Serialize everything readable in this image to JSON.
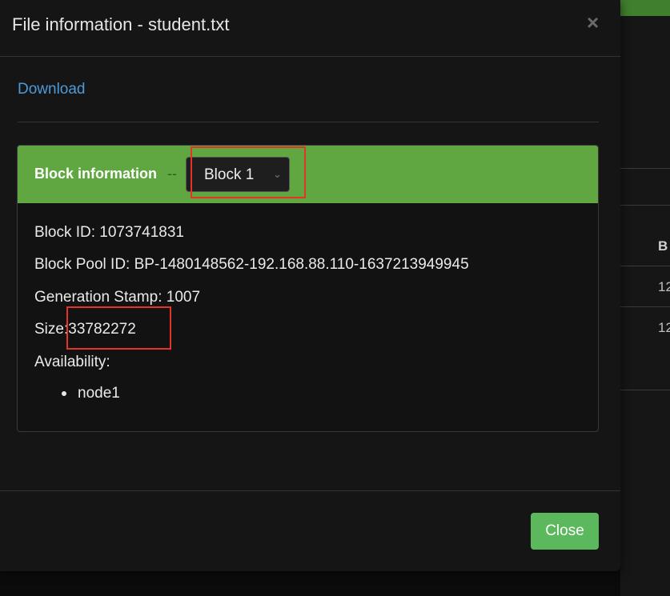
{
  "background": {
    "column_header": "B",
    "row_values": [
      "12",
      "12"
    ]
  },
  "modal": {
    "title": "File information - student.txt",
    "close_symbol": "×",
    "download_label": "Download",
    "block_panel": {
      "heading": "Block information",
      "separator": "--",
      "selected_block": "Block 1",
      "chevron_symbol": "⌄",
      "fields": {
        "block_id": "Block ID: 1073741831",
        "block_pool_id": "Block Pool ID: BP-1480148562-192.168.88.110-1637213949945",
        "generation_stamp": "Generation Stamp: 1007",
        "size_label": "Size:",
        "size_value": "33782272",
        "availability_label": "Availability:"
      },
      "nodes": [
        "node1"
      ]
    },
    "footer": {
      "close_label": "Close"
    }
  },
  "colors": {
    "panel_heading": "#60a741",
    "close_button": "#5cb85c",
    "link": "#4d9ad8",
    "highlight_box": "#e5332a"
  }
}
